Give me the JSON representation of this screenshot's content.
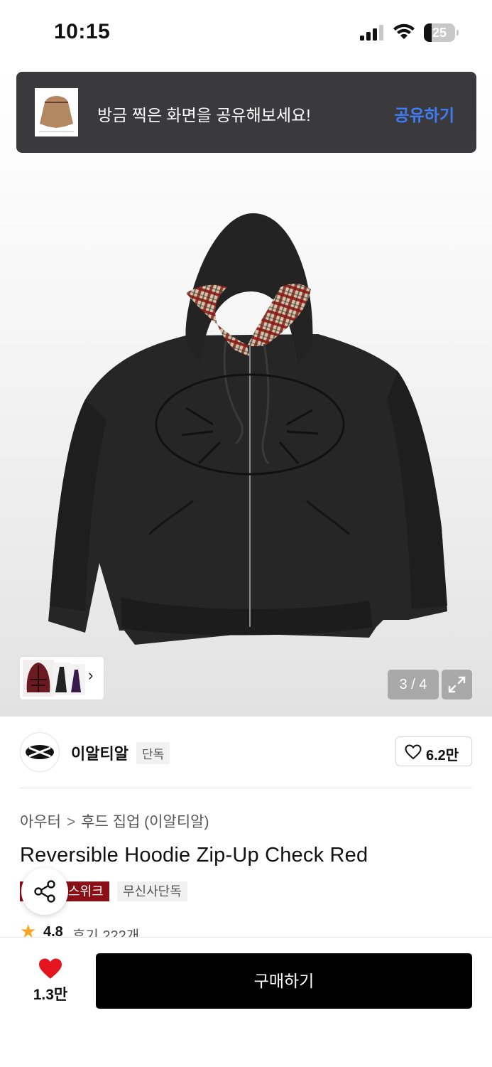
{
  "status_bar": {
    "time": "10:15",
    "battery": "25",
    "battery_level": 0.25
  },
  "share_toast": {
    "message": "방금 찍은 화면을 공유해보세요!",
    "action": "공유하기"
  },
  "gallery": {
    "counter": "3 / 4"
  },
  "brand": {
    "name": "이알티알",
    "badge": "단독",
    "likes": "6.2만"
  },
  "breadcrumb": {
    "category": "아우터",
    "separator": ">",
    "subcategory": "후드 집업 (이알티알)"
  },
  "product": {
    "title": "Reversible Hoodie Zip-Up Check Red",
    "tags": [
      "스위크",
      "무신사단독"
    ],
    "rating": "4.8",
    "reviews": "후기 222개"
  },
  "bottom_bar": {
    "like_count": "1.3만",
    "buy_label": "구매하기"
  },
  "colors": {
    "toast_bg": "#3a3a3c",
    "toast_action": "#3f7cf6",
    "tag_red": "#8b0f17",
    "heart": "#e4151f",
    "star": "#f5a623",
    "buy_bg": "#000000"
  }
}
